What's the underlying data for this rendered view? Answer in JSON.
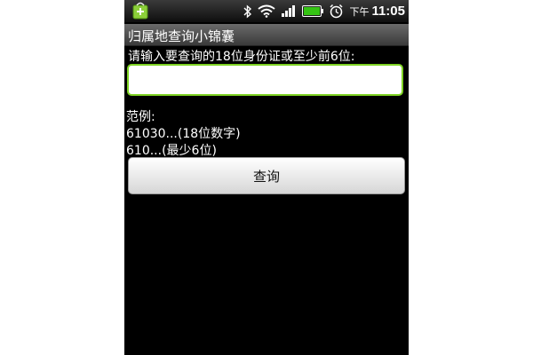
{
  "status_bar": {
    "app_icon": "android-market-icon",
    "icons": [
      "bluetooth-icon",
      "wifi-icon",
      "signal-icon",
      "battery-icon",
      "alarm-icon"
    ],
    "ampm": "下午",
    "time": "11:05"
  },
  "app": {
    "title": "归属地查询小锦囊"
  },
  "form": {
    "prompt": "请输入要查询的18位身份证或至少前6位:",
    "input_value": "",
    "input_placeholder": "",
    "examples_label": "范例:",
    "example_1": "61030...(18位数字)",
    "example_2": "610...(最少6位)",
    "query_button": "查询"
  },
  "colors": {
    "background": "#000000",
    "input_border": "#7fd324",
    "text": "#ffffff"
  }
}
